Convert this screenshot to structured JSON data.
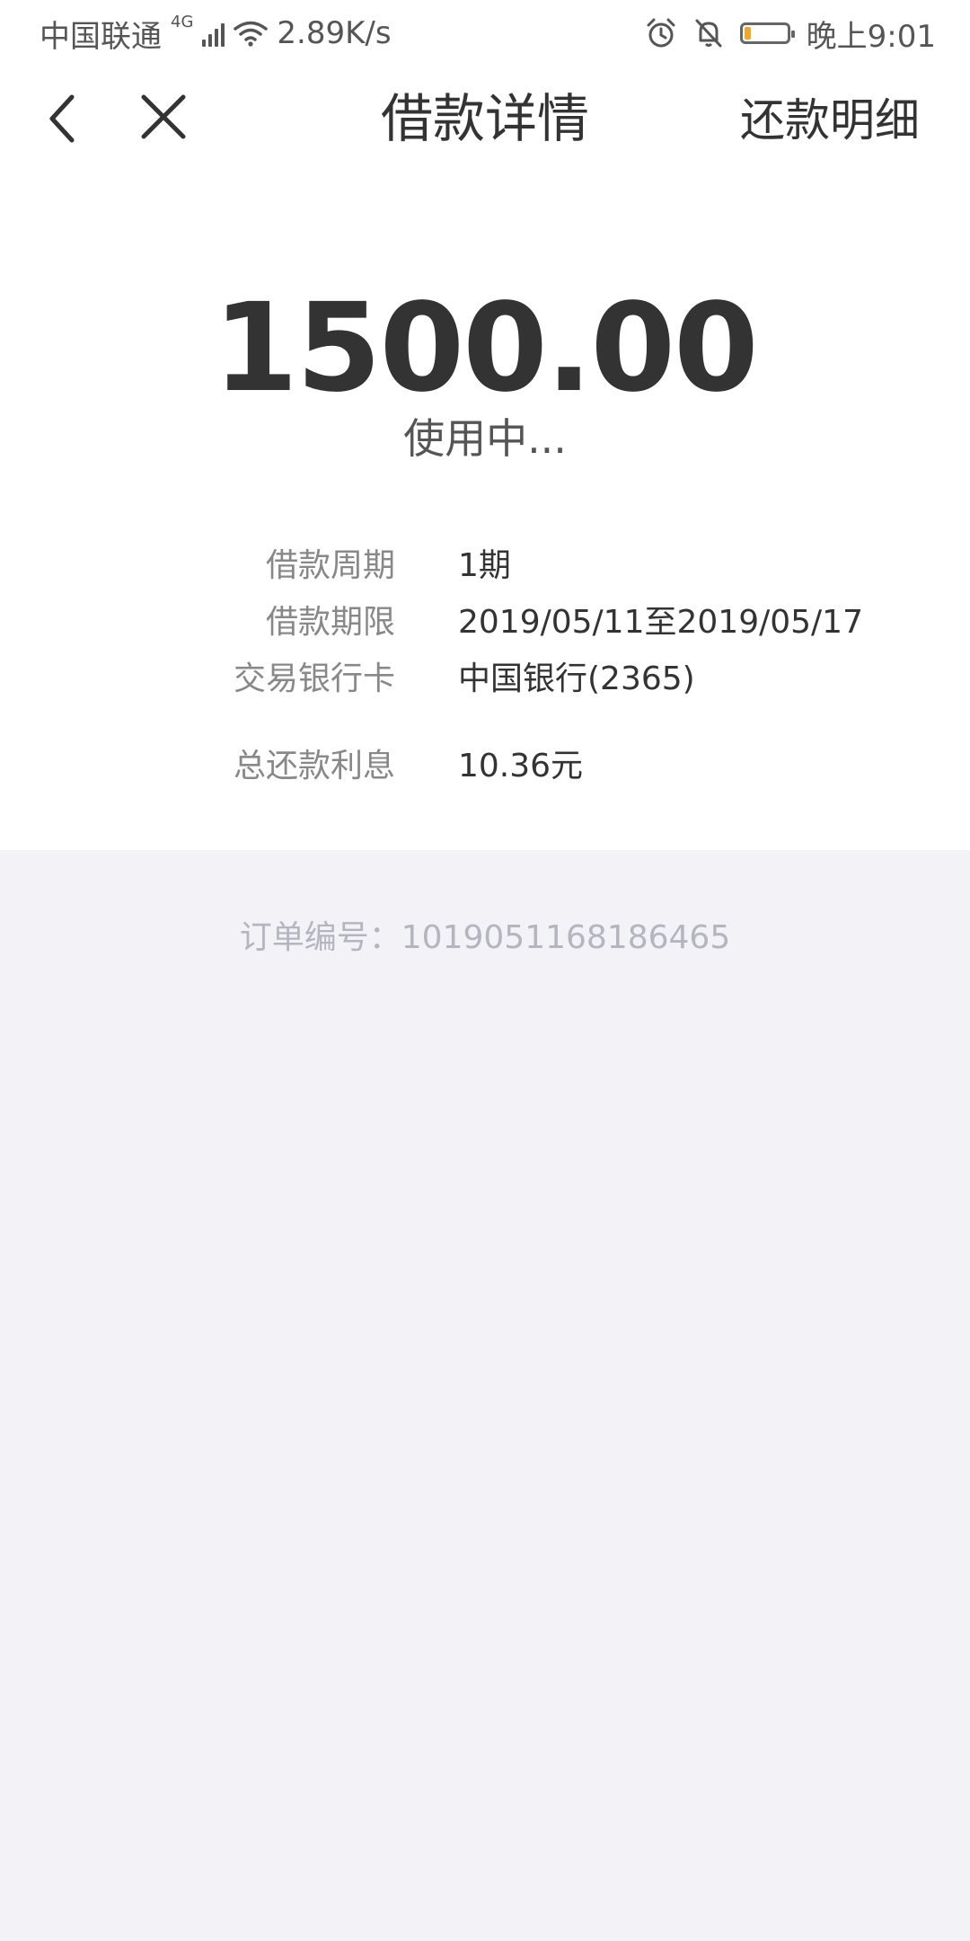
{
  "status_bar": {
    "carrier": "中国联通",
    "network_type": "4G",
    "speed": "2.89K/s",
    "time": "晚上9:01",
    "battery_level": 0.15,
    "battery_color": "#f5a623"
  },
  "nav": {
    "back_icon": "chevron-left-icon",
    "close_icon": "close-icon",
    "title": "借款详情",
    "right_link": "还款明细"
  },
  "loan": {
    "amount": "1500.00",
    "status": "使用中...",
    "details": [
      {
        "label": "借款周期",
        "value": "1期"
      },
      {
        "label": "借款期限",
        "value": "2019/05/11至2019/05/17"
      },
      {
        "label": "交易银行卡",
        "value": "中国银行(2365)"
      },
      {
        "label": "总还款利息",
        "value": "10.36元"
      }
    ]
  },
  "order": {
    "label": "订单编号：",
    "number": "1019051168186465"
  },
  "colors": {
    "background": "#f2f2f7",
    "card": "#ffffff",
    "text_primary": "#333333",
    "text_label": "#888888",
    "text_muted": "#b5b5bf"
  }
}
